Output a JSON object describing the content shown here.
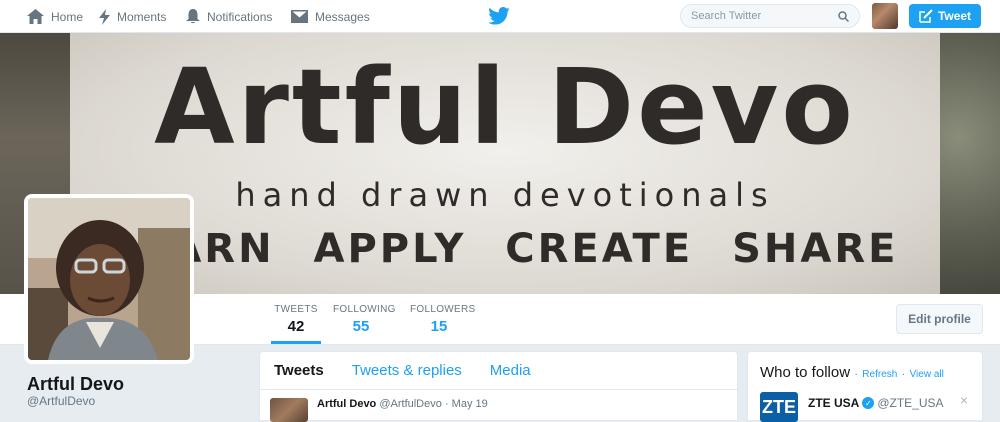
{
  "nav": {
    "home": "Home",
    "moments": "Moments",
    "notifications": "Notifications",
    "messages": "Messages",
    "search_placeholder": "Search Twitter",
    "tweet_button": "Tweet"
  },
  "banner": {
    "title": "Artful Devo",
    "subtitle": "hand drawn devotionals",
    "tags": "LEARN APPLY CREATE SHARE"
  },
  "stats": [
    {
      "label": "TWEETS",
      "value": "42"
    },
    {
      "label": "FOLLOWING",
      "value": "55"
    },
    {
      "label": "FOLLOWERS",
      "value": "15"
    }
  ],
  "edit_profile": "Edit profile",
  "profile": {
    "name": "Artful Devo",
    "handle": "@ArtfulDevo"
  },
  "tweets_panel": {
    "tabs": [
      "Tweets",
      "Tweets & replies",
      "Media"
    ],
    "first_tweet": {
      "name": "Artful Devo",
      "handle": "@ArtfulDevo",
      "date": "· May 19"
    }
  },
  "who_to_follow": {
    "title": "Who to follow",
    "refresh": "Refresh",
    "view_all": "View all",
    "sep": "·",
    "suggestion": {
      "name": "ZTE USA",
      "handle": "@ZTE_USA",
      "avatar_text": "ZTE",
      "close": "×"
    }
  },
  "colors": {
    "accent": "#1da1f2",
    "background": "#e6ecf0"
  }
}
